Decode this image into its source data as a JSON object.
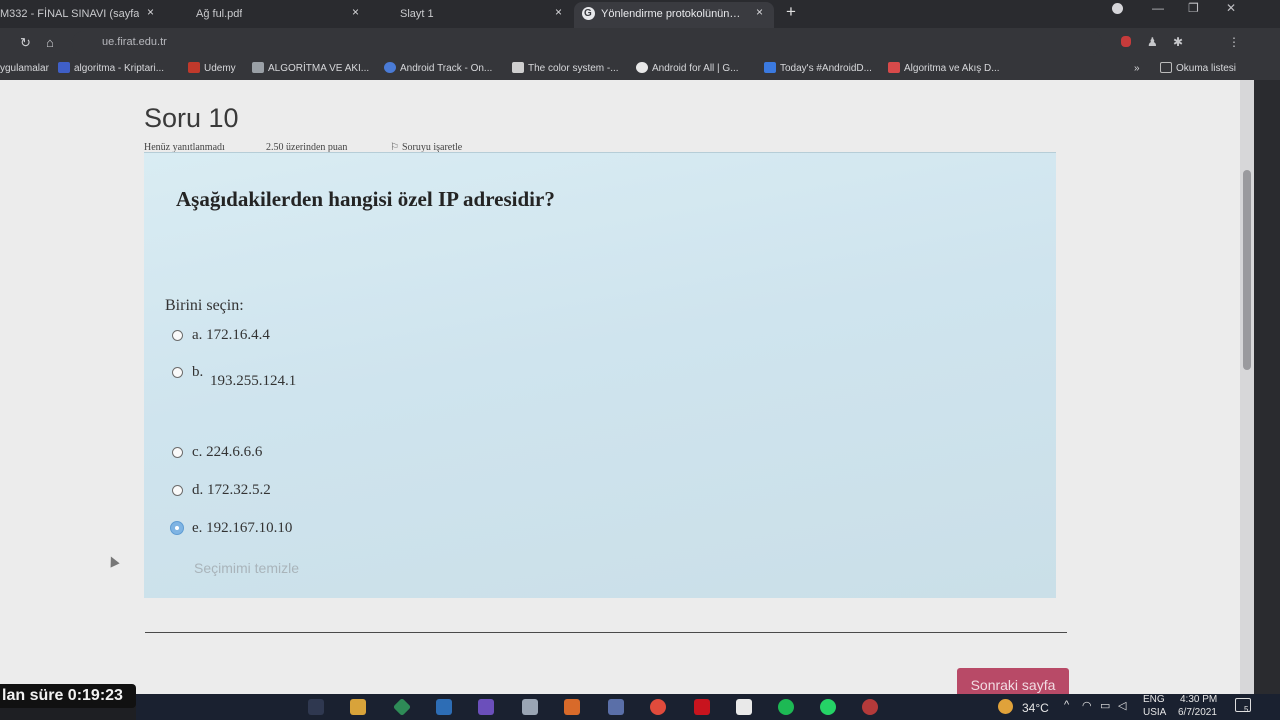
{
  "browser": {
    "tabs": [
      {
        "title": "M332 - FİNAL SINAVI (sayfa",
        "active": false
      },
      {
        "title": "Ağ ful.pdf",
        "active": false
      },
      {
        "title": "Slayt 1",
        "active": false
      },
      {
        "title": "Yönlendirme protokolünün am",
        "active": true
      }
    ],
    "close_glyph": "×",
    "new_tab_glyph": "+",
    "url": "ue.firat.edu.tr",
    "bookmarks": [
      {
        "label": "ygulamalar",
        "icon_color": "#4a7bd6"
      },
      {
        "label": "algoritma - Kriptari...",
        "icon_color": "#3f5fc7"
      },
      {
        "label": "Udemy",
        "icon_color": "#c0392b"
      },
      {
        "label": "ALGORİTMA VE AKI...",
        "icon_color": "#9aa0a6"
      },
      {
        "label": "Android Track - On...",
        "icon_color": "#4a7bd6"
      },
      {
        "label": "The color system -...",
        "icon_color": "#cfcfcf"
      },
      {
        "label": "Android for All  |  G...",
        "icon_color": "#e8e8e8"
      },
      {
        "label": "Today's #AndroidD...",
        "icon_color": "#3b7ae0"
      },
      {
        "label": "Algoritma ve Akış D...",
        "icon_color": "#d84a4a"
      }
    ],
    "reading_list": "Okuma listesi"
  },
  "quiz": {
    "title": "Soru 10",
    "status": "Henüz yanıtlanmadı",
    "points": "2.50 üzerinden puan",
    "flag_label": "Soruyu işaretle",
    "question": "Aşağıdakilerden hangisi özel IP adresidir?",
    "prompt": "Birini seçin:",
    "options": [
      {
        "label": "a. 172.16.4.4",
        "selected": false
      },
      {
        "label": "b.",
        "sublabel": "193.255.124.1",
        "selected": false
      },
      {
        "label": "c. 224.6.6.6",
        "selected": false
      },
      {
        "label": "d. 172.32.5.2",
        "selected": false
      },
      {
        "label": "e. 192.167.10.10",
        "selected": true
      }
    ],
    "clear_choice": "Seçimimi temizle",
    "next_button": "Sonraki sayfa"
  },
  "timer": "lan süre 0:19:23",
  "taskbar": {
    "temperature": "34°C",
    "language": "ENG",
    "region": "USIA",
    "time": "4:30 PM",
    "date": "6/7/2021",
    "notifications": "5"
  }
}
